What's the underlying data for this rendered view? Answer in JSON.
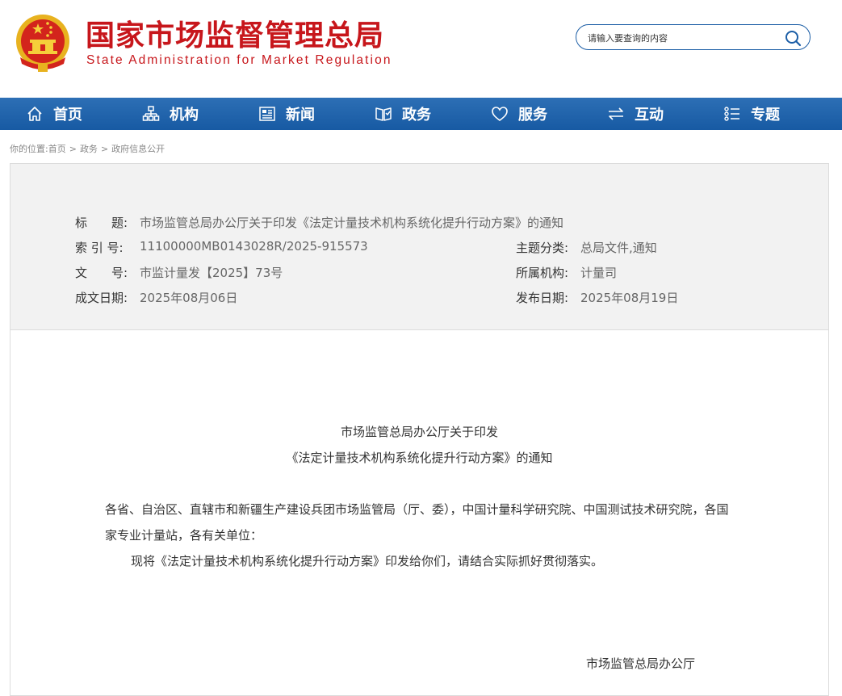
{
  "header": {
    "brand_cn": "国家市场监督管理总局",
    "brand_en": "State Administration for Market Regulation",
    "search_placeholder": "请输入要查询的内容"
  },
  "nav": {
    "items": [
      {
        "label": "首页",
        "icon": "home-icon"
      },
      {
        "label": "机构",
        "icon": "org-icon"
      },
      {
        "label": "新闻",
        "icon": "news-icon"
      },
      {
        "label": "政务",
        "icon": "gov-icon"
      },
      {
        "label": "服务",
        "icon": "heart-icon"
      },
      {
        "label": "互动",
        "icon": "exchange-icon"
      },
      {
        "label": "专题",
        "icon": "list-icon"
      }
    ]
  },
  "breadcrumb": {
    "prefix": "你的位置:",
    "items": [
      "首页",
      "政务",
      "政府信息公开"
    ],
    "separator": ">"
  },
  "meta": {
    "title_label": "标　　题:",
    "title_value": "市场监管总局办公厅关于印发《法定计量技术机构系统化提升行动方案》的通知",
    "index_label": "索 引 号:",
    "index_value": "11100000MB0143028R/2025-915573",
    "topic_label": "主题分类:",
    "topic_value": "总局文件,通知",
    "docno_label": "文　　号:",
    "docno_value": "市监计量发【2025】73号",
    "org_label": "所属机构:",
    "org_value": "计量司",
    "date_label": "成文日期:",
    "date_value": "2025年08月06日",
    "pubdate_label": "发布日期:",
    "pubdate_value": "2025年08月19日"
  },
  "document": {
    "title_line1": "市场监管总局办公厅关于印发",
    "title_line2": "《法定计量技术机构系统化提升行动方案》的通知",
    "addressees": "各省、自治区、直辖市和新疆生产建设兵团市场监管局（厅、委），中国计量科学研究院、中国测试技术研究院，各国家专业计量站，各有关单位：",
    "body": "现将《法定计量技术机构系统化提升行动方案》印发给你们，请结合实际抓好贯彻落实。",
    "signature": "市场监管总局办公厅"
  },
  "colors": {
    "brand_red": "#c7161b",
    "nav_blue": "#1c5ea6",
    "meta_bg": "#f2f2f2"
  }
}
